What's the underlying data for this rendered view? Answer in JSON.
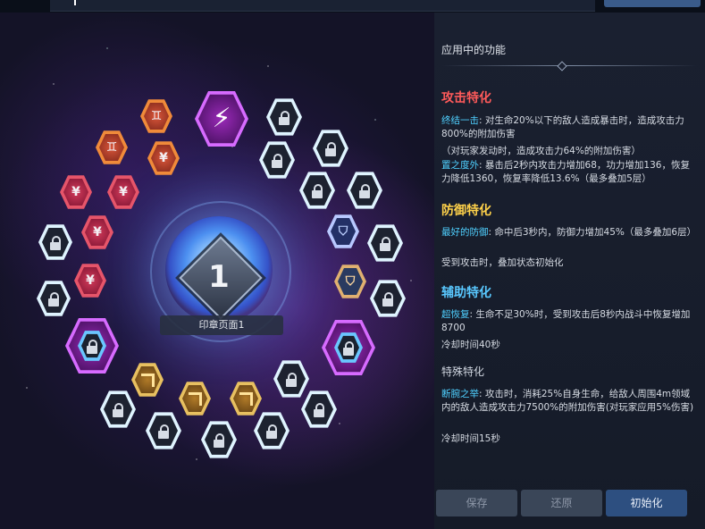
{
  "emblem_page": {
    "number": "1",
    "label": "印章页面1"
  },
  "panel": {
    "title": "应用中的功能",
    "sections": [
      {
        "title": "攻击特化",
        "entries": [
          {
            "name": "终结一击",
            "text": ": 对生命20%以下的敌人造成暴击时，造成攻击力800%的附加伤害"
          },
          {
            "name": "",
            "text": "（对玩家发动时，造成攻击力64%的附加伤害）"
          },
          {
            "name": "置之度外",
            "text": ": 暴击后2秒内攻击力增加68，功力增加136，恢复力降低1360，恢复率降低13.6%（最多叠加5层）"
          }
        ]
      },
      {
        "title": "防御特化",
        "entries": [
          {
            "name": "最好的防御",
            "text": ": 命中后3秒内，防御力增加45%（最多叠加6层）"
          },
          {
            "name": "",
            "text": "受到攻击时，叠加状态初始化"
          }
        ]
      },
      {
        "title": "辅助特化",
        "entries": [
          {
            "name": "超恢复",
            "text": ": 生命不足30%时，受到攻击后8秒内战斗中恢复增加8700"
          },
          {
            "name": "",
            "text": "冷却时间40秒"
          }
        ]
      },
      {
        "title": "特殊特化",
        "entries": [
          {
            "name": "断腕之举",
            "text": ": 攻击时，消耗25%自身生命，给敌人周围4m领域内的敌人造成攻击力7500%的附加伤害(对玩家应用5%伤害)"
          },
          {
            "name": "",
            "text": "冷却时间15秒"
          }
        ]
      }
    ]
  },
  "buttons": {
    "save": "保存",
    "restore": "还原",
    "reset": "初始化"
  },
  "slot_glyphs": {
    "gemini": "♊",
    "yen": "¥",
    "shield": "⛉"
  },
  "colors": {
    "attack": "#ff5a5a",
    "defense": "#ffd24a",
    "support": "#59c8ff",
    "highlight": "#4fd0ff"
  }
}
